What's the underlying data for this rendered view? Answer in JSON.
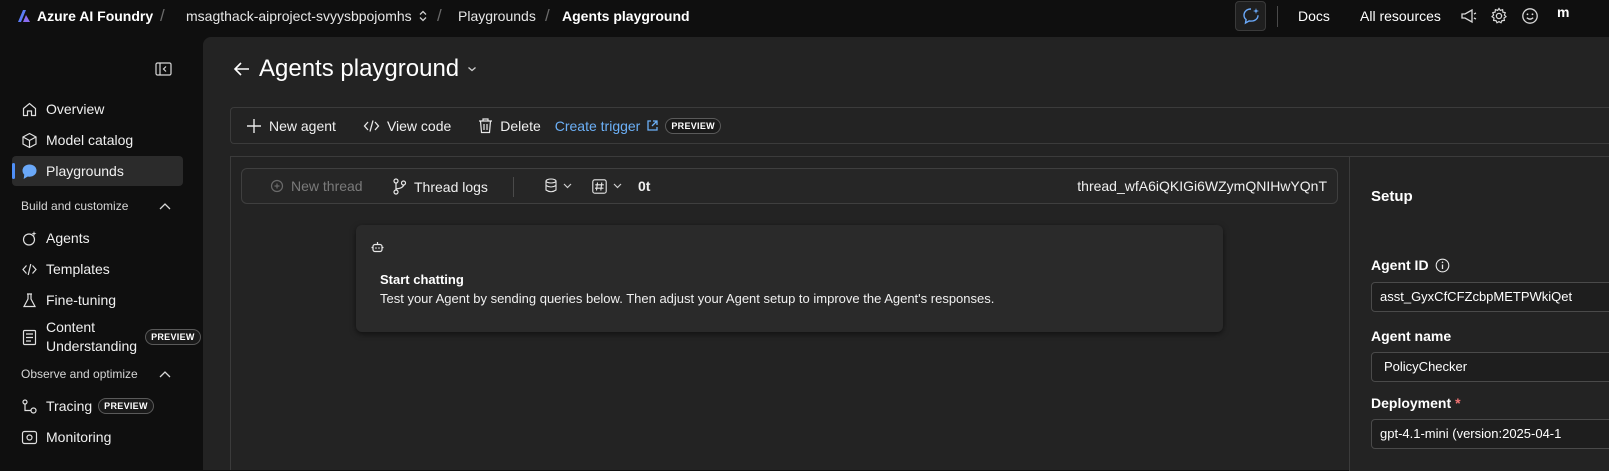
{
  "topbar": {
    "brand": "Azure AI Foundry",
    "project": "msagthack-aiproject-svyysbpojomhs",
    "breadcrumb_playgrounds": "Playgrounds",
    "breadcrumb_current": "Agents playground",
    "docs": "Docs",
    "all_resources": "All resources",
    "avatar_fragment": "m"
  },
  "sidebar": {
    "overview": "Overview",
    "model_catalog": "Model catalog",
    "playgrounds": "Playgrounds",
    "section_build": "Build and customize",
    "agents": "Agents",
    "templates": "Templates",
    "fine_tuning": "Fine-tuning",
    "content_understanding_1": "Content",
    "content_understanding_2": "Understanding",
    "preview_badge": "PREVIEW",
    "section_observe": "Observe and optimize",
    "tracing": "Tracing",
    "monitoring": "Monitoring"
  },
  "page": {
    "title": "Agents playground"
  },
  "toolbar": {
    "new_agent": "New agent",
    "view_code": "View code",
    "delete": "Delete",
    "create_trigger": "Create trigger",
    "preview_badge": "PREVIEW"
  },
  "thread": {
    "new_thread": "New thread",
    "thread_logs": "Thread logs",
    "token_count": "0t",
    "thread_id": "thread_wfA6iQKIGi6WZymQNIHwYQnT"
  },
  "chat": {
    "title": "Start chatting",
    "text": "Test your Agent by sending queries below. Then adjust your Agent setup to improve the Agent's responses."
  },
  "setup": {
    "title": "Setup",
    "agent_id_label": "Agent ID",
    "agent_id_value": "asst_GyxCfCFZcbpMETPWkiQet",
    "agent_name_label": "Agent name",
    "agent_name_value": "PolicyChecker",
    "deployment_label": "Deployment",
    "deployment_required": "*",
    "deployment_value": "gpt-4.1-mini (version:2025-04-1"
  },
  "colors": {
    "accent": "#4f8ff7",
    "link": "#6cb0f7",
    "required": "#f27474",
    "background": "#0f0f0f",
    "panel": "#232323"
  }
}
